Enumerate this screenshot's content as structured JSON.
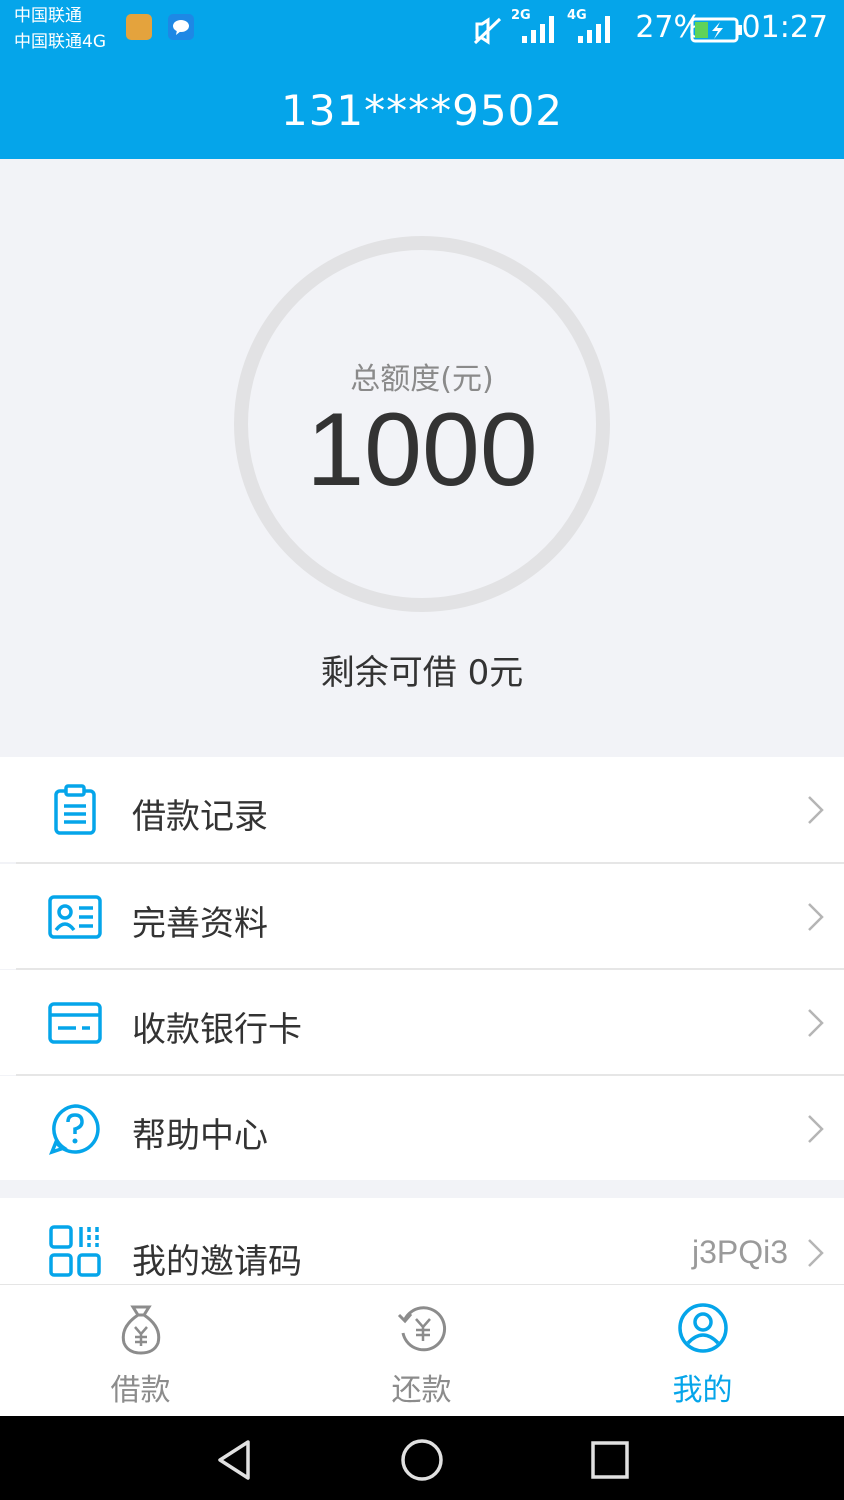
{
  "status_bar": {
    "carrier1": "中国联通",
    "carrier2": "中国联通4G",
    "network_a": "2G",
    "network_b": "4G",
    "battery": "27%",
    "time": "01:27",
    "icons": [
      "notification-app-icon",
      "message-icon",
      "mute-icon",
      "signal-icon",
      "battery-icon"
    ]
  },
  "header": {
    "title": "131****9502"
  },
  "quota": {
    "label": "总额度(元)",
    "value": "1000",
    "remaining": "剩余可借 0元"
  },
  "menu": {
    "items": [
      {
        "label": "借款记录",
        "icon": "clipboard-icon"
      },
      {
        "label": "完善资料",
        "icon": "id-card-icon"
      },
      {
        "label": "收款银行卡",
        "icon": "bank-card-icon"
      },
      {
        "label": "帮助中心",
        "icon": "help-icon"
      }
    ],
    "invite": {
      "label": "我的邀请码",
      "value": "j3PQi3",
      "icon": "qr-code-icon"
    }
  },
  "tabs": [
    {
      "label": "借款",
      "icon": "money-bag-icon",
      "active": false
    },
    {
      "label": "还款",
      "icon": "repay-icon",
      "active": false
    },
    {
      "label": "我的",
      "icon": "profile-icon",
      "active": true
    }
  ],
  "colors": {
    "accent": "#05a5ea",
    "background": "#f2f3f7",
    "ring": "#e2e2e4"
  }
}
